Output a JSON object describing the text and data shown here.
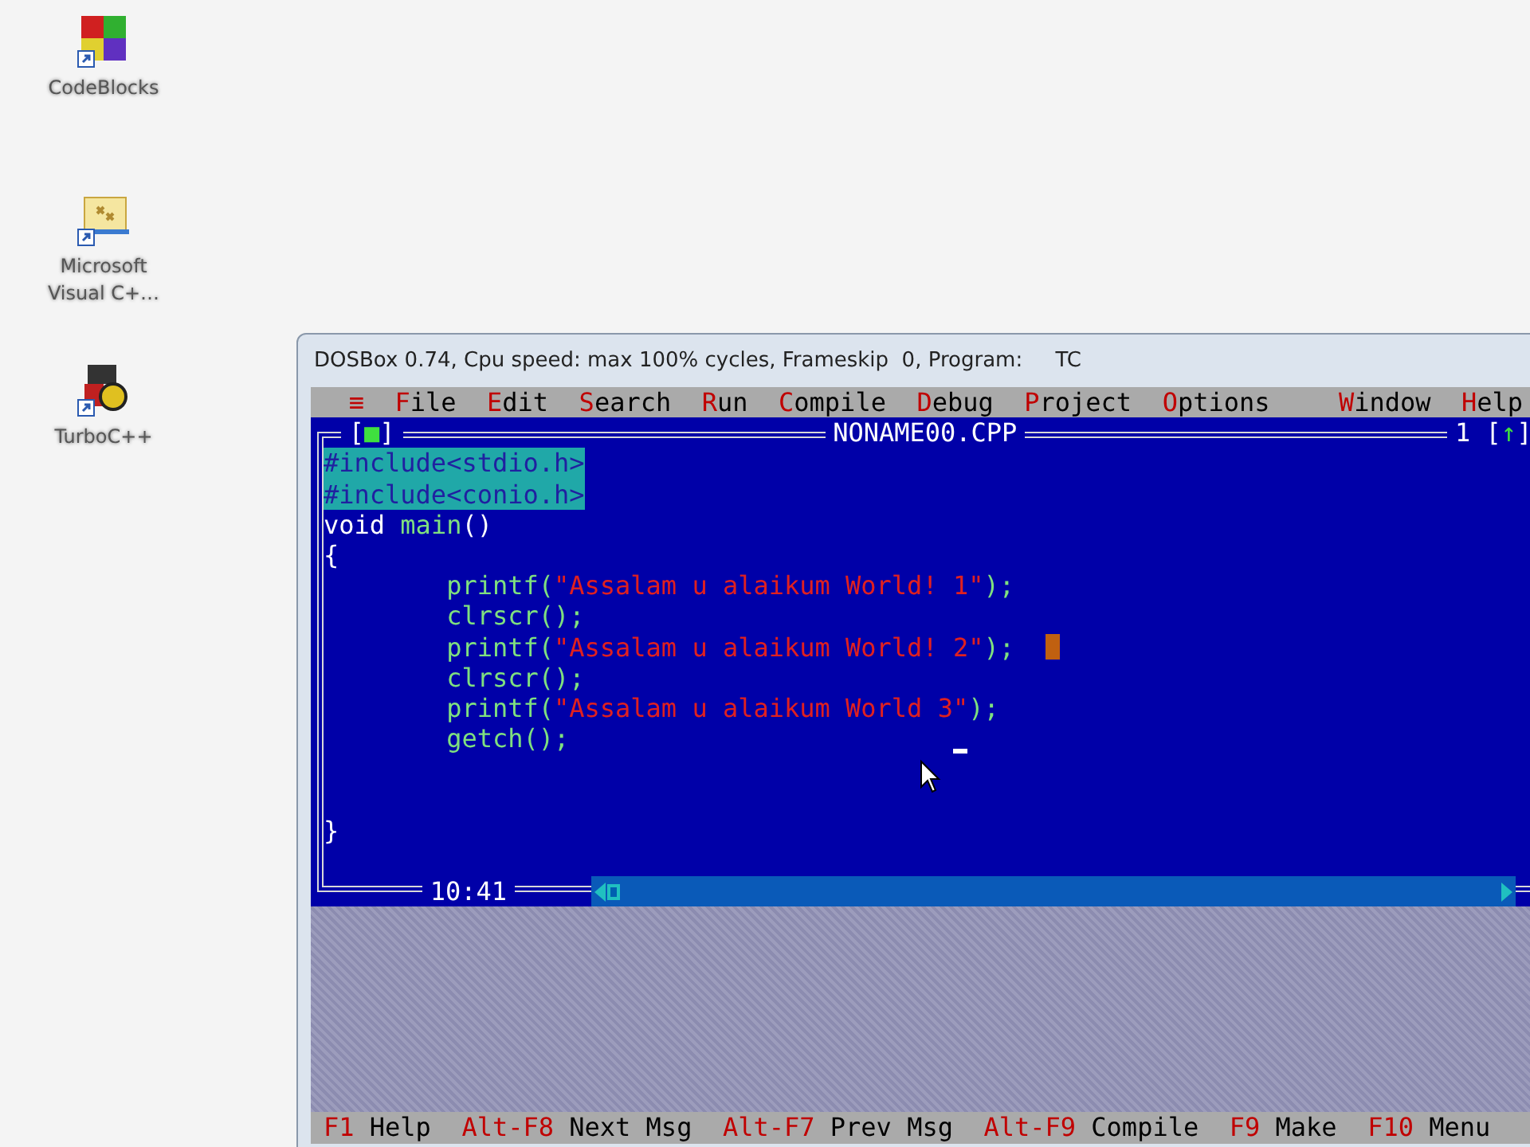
{
  "desktop_icons": [
    {
      "label": "CodeBlocks",
      "kind": "codeblocks"
    },
    {
      "label": "Microsoft Visual C+…",
      "kind": "visual"
    },
    {
      "label": "TurboC++",
      "kind": "turbo"
    }
  ],
  "window": {
    "title": "DOSBox 0.74, Cpu speed: max 100% cycles, Frameskip  0, Program:     TC"
  },
  "menu": {
    "left": [
      "≡",
      "File",
      "Edit",
      "Search",
      "Run",
      "Compile",
      "Debug",
      "Project",
      "Options"
    ],
    "right": [
      "Window",
      "Help"
    ]
  },
  "editor": {
    "close_box": "[■]",
    "file_name": "NONAME00.CPP",
    "window_number": "1",
    "zoom_box": "[↑]",
    "position": "10:41",
    "lines": [
      {
        "kind": "top",
        "selected": true,
        "cursor": false,
        "caret": false,
        "segments": [
          {
            "text": "#include<stdio.h>",
            "kind": "plain"
          }
        ]
      },
      {
        "kind": "top",
        "selected": true,
        "cursor": false,
        "caret": false,
        "segments": [
          {
            "text": "#include<conio.h>",
            "kind": "plain"
          }
        ]
      },
      {
        "kind": "top",
        "selected": false,
        "cursor": false,
        "caret": false,
        "segments": [
          {
            "text": "void ",
            "kind": "keyword"
          },
          {
            "text": "main",
            "kind": "ident"
          },
          {
            "text": "()",
            "kind": "keyword"
          }
        ]
      },
      {
        "kind": "top",
        "selected": false,
        "cursor": false,
        "caret": false,
        "segments": [
          {
            "text": "{",
            "kind": "keyword"
          }
        ]
      },
      {
        "kind": "body",
        "selected": false,
        "cursor": false,
        "caret": false,
        "segments": [
          {
            "text": "printf(",
            "kind": "ident"
          },
          {
            "text": "\"Assalam u alaikum World! 1\"",
            "kind": "string"
          },
          {
            "text": ");",
            "kind": "ident"
          }
        ]
      },
      {
        "kind": "body",
        "selected": false,
        "cursor": false,
        "caret": false,
        "segments": [
          {
            "text": "clrscr();",
            "kind": "ident"
          }
        ]
      },
      {
        "kind": "body",
        "selected": false,
        "cursor": true,
        "caret": false,
        "segments": [
          {
            "text": "printf(",
            "kind": "ident"
          },
          {
            "text": "\"Assalam u alaikum World! 2\"",
            "kind": "string"
          },
          {
            "text": ");",
            "kind": "ident"
          }
        ]
      },
      {
        "kind": "body",
        "selected": false,
        "cursor": false,
        "caret": false,
        "segments": [
          {
            "text": "clrscr();",
            "kind": "ident"
          }
        ]
      },
      {
        "kind": "body",
        "selected": false,
        "cursor": false,
        "caret": false,
        "segments": [
          {
            "text": "printf(",
            "kind": "ident"
          },
          {
            "text": "\"Assalam u alaikum World 3\"",
            "kind": "string"
          },
          {
            "text": ");",
            "kind": "ident"
          }
        ]
      },
      {
        "kind": "body",
        "selected": false,
        "cursor": false,
        "caret": true,
        "segments": [
          {
            "text": "getch();",
            "kind": "ident"
          }
        ]
      },
      {
        "kind": "blank"
      },
      {
        "kind": "blank"
      },
      {
        "kind": "top",
        "selected": false,
        "cursor": false,
        "caret": false,
        "segments": [
          {
            "text": "}",
            "kind": "keyword"
          }
        ]
      }
    ]
  },
  "status_bar": [
    {
      "key": "F1",
      "label": "Help"
    },
    {
      "key": "Alt-F8",
      "label": "Next Msg"
    },
    {
      "key": "Alt-F7",
      "label": "Prev Msg"
    },
    {
      "key": "Alt-F9",
      "label": "Compile"
    },
    {
      "key": "F9",
      "label": "Make"
    },
    {
      "key": "F10",
      "label": "Menu"
    }
  ]
}
